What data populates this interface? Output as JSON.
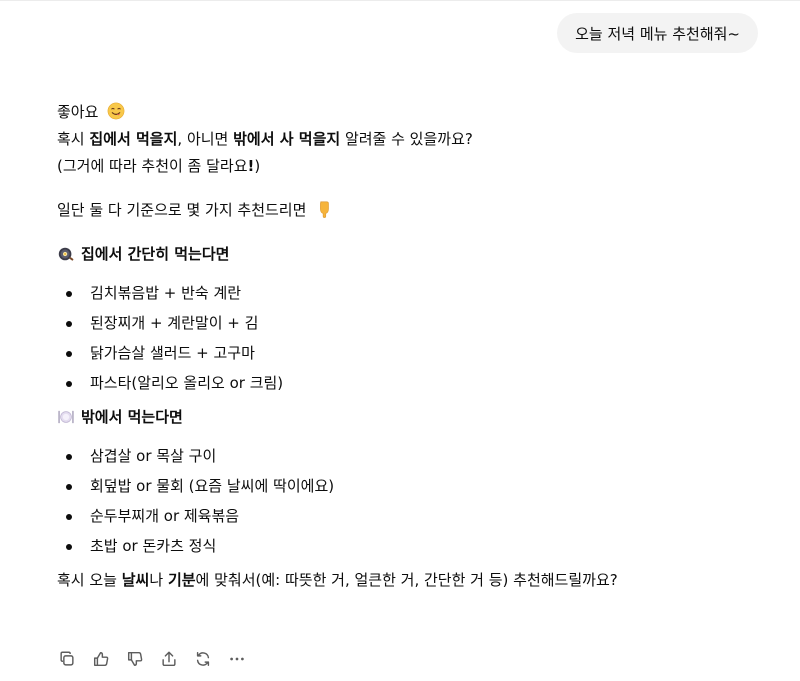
{
  "user_message": "오늘 저녁 메뉴 추천해줘~",
  "reply": {
    "greeting": "좋아요",
    "greeting_emoji": "yum-face-emoji",
    "question_parts": [
      "혹시 ",
      "집에서 먹을지",
      ", 아니면 ",
      "밖에서 사 먹을지",
      " 알려줄 수 있을까요?"
    ],
    "paren_parts": [
      "(그거에 따라 추천이 좀 달라요",
      "!",
      ")"
    ],
    "intro": "일단 둘 다 기준으로 몇 가지 추천드리면",
    "intro_emoji": "pointing-down-emoji",
    "home": {
      "icon": "cooking-pan-icon",
      "title": "집에서 간단히 먹는다면",
      "items": [
        "김치볶음밥 + 반숙 계란",
        "된장찌개 + 계란말이 + 김",
        "닭가슴살 샐러드 + 고구마",
        "파스타(알리오 올리오 or 크림)"
      ]
    },
    "out": {
      "icon": "fork-knife-plate-icon",
      "title": "밖에서 먹는다면",
      "items": [
        "삼겹살 or 목살 구이",
        "회덮밥 or 물회 (요즘 날씨에 딱이에요)",
        "순두부찌개 or 제육볶음",
        "초밥 or 돈카츠 정식"
      ]
    },
    "closing_parts": [
      "혹시 오늘 ",
      "날씨",
      "나 ",
      "기분",
      "에 맞춰서(예: 따뜻한 거, 얼큰한 거, 간단한 거 등) 추천해드릴까요?"
    ]
  },
  "actions": [
    "copy-icon",
    "thumbs-up-icon",
    "thumbs-down-icon",
    "share-icon",
    "regenerate-icon",
    "more-icon"
  ],
  "colors": {
    "user_bubble_bg": "#f3f3f3",
    "text": "#0d0d0d",
    "icon": "#5d5d5d"
  }
}
